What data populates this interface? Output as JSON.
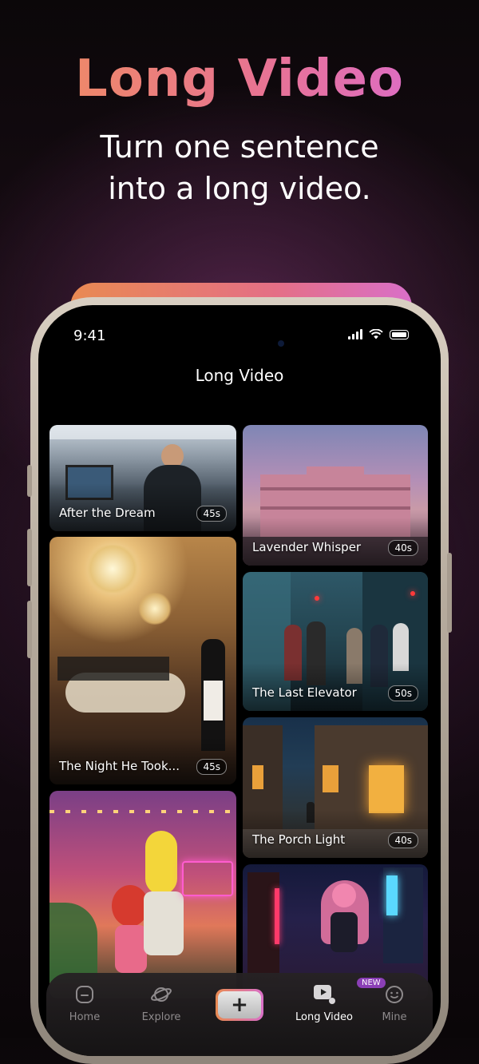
{
  "promo": {
    "title": "Long Video",
    "subtitle_line1": "Turn one sentence",
    "subtitle_line2": "into a long video."
  },
  "status_bar": {
    "time": "9:41"
  },
  "screen": {
    "title": "Long Video"
  },
  "cards": [
    {
      "title": "After the Dream",
      "duration": "45s"
    },
    {
      "title": "Lavender Whisper",
      "duration": "40s"
    },
    {
      "title": "The Night He Took...",
      "duration": "45s"
    },
    {
      "title": "The Last Elevator",
      "duration": "50s"
    },
    {
      "title": "The Porch Light",
      "duration": "40s"
    },
    {
      "title": "",
      "duration": ""
    },
    {
      "title": "",
      "duration": ""
    }
  ],
  "tabbar": {
    "home": "Home",
    "explore": "Explore",
    "create": "+",
    "long_video": "Long Video",
    "long_video_badge": "NEW",
    "mine": "Mine"
  },
  "colors": {
    "title_gradient_start": "#f0905a",
    "title_gradient_end": "#d96ad9",
    "badge": "#8b3fb6"
  }
}
